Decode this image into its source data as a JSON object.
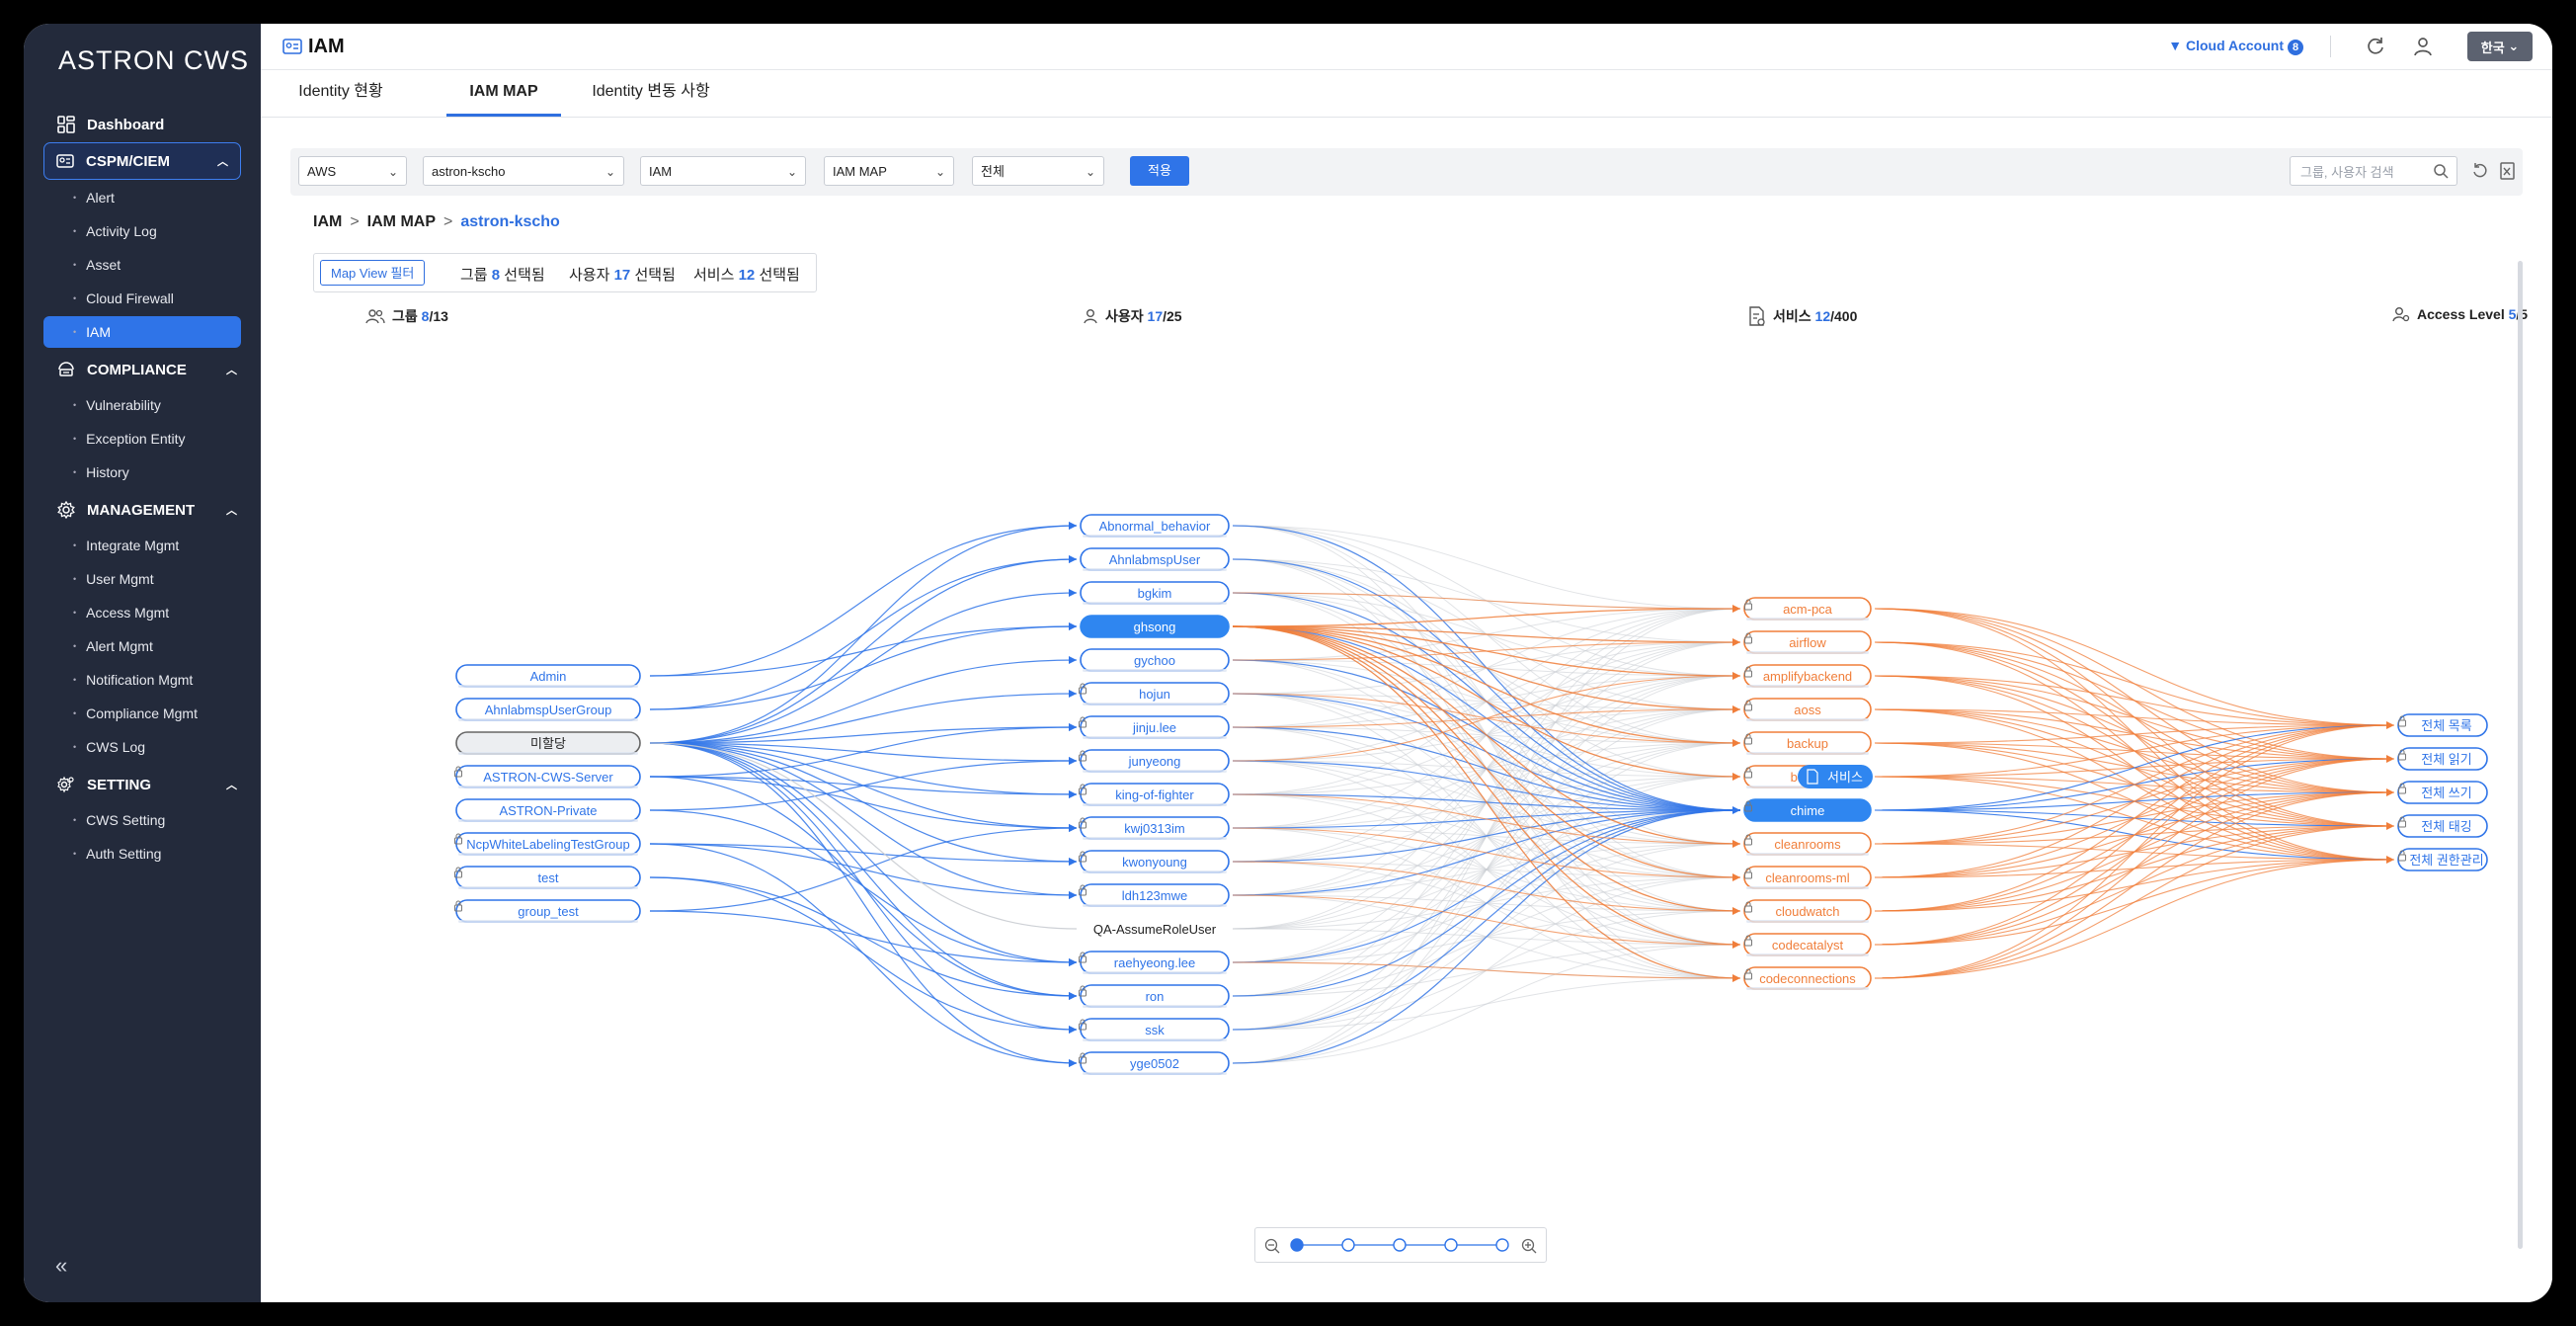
{
  "brand": "ASTRON CWS",
  "sidebar": {
    "dashboard": "Dashboard",
    "sections": [
      {
        "label": "CSPM/CIEM",
        "icon": "cspm-icon",
        "items": [
          "Alert",
          "Activity Log",
          "Asset",
          "Cloud Firewall",
          "IAM"
        ]
      },
      {
        "label": "COMPLIANCE",
        "icon": "compliance-icon",
        "items": [
          "Vulnerability",
          "Exception Entity",
          "History"
        ]
      },
      {
        "label": "MANAGEMENT",
        "icon": "gear-icon",
        "items": [
          "Integrate Mgmt",
          "User Mgmt",
          "Access Mgmt",
          "Alert Mgmt",
          "Notification Mgmt",
          "Compliance Mgmt",
          "CWS Log"
        ]
      },
      {
        "label": "SETTING",
        "icon": "setting-icon",
        "items": [
          "CWS Setting",
          "Auth Setting"
        ]
      }
    ],
    "active_item": "IAM",
    "collapse_label": "«"
  },
  "header": {
    "title": "IAM",
    "cloud_account_label": "▼ Cloud Account",
    "cloud_account_count": "8",
    "lang_label": "한국"
  },
  "tabs": [
    {
      "label": "Identity 현황",
      "active": false
    },
    {
      "label": "IAM MAP",
      "active": true
    },
    {
      "label": "Identity 변동 사항",
      "active": false
    }
  ],
  "filters": {
    "cloud": "AWS",
    "account": "astron-kscho",
    "service": "IAM",
    "view": "IAM MAP",
    "scope": "전체",
    "apply_label": "적용",
    "search_placeholder": "그룹, 사용자 검색"
  },
  "breadcrumb": {
    "root": "IAM",
    "middle": "IAM MAP",
    "current": "astron-kscho",
    "sep": ">"
  },
  "map_filter": {
    "button_label": "Map View 필터",
    "stats": [
      {
        "prefix": "그룹",
        "value": "8",
        "suffix": "선택됨"
      },
      {
        "prefix": "사용자",
        "value": "17",
        "suffix": "선택됨"
      },
      {
        "prefix": "서비스",
        "value": "12",
        "suffix": "선택됨"
      }
    ]
  },
  "columns": [
    {
      "label": "그룹",
      "selected": "8",
      "total": "/13"
    },
    {
      "label": "사용자",
      "selected": "17",
      "total": "/25"
    },
    {
      "label": "서비스",
      "selected": "12",
      "total": "/400"
    },
    {
      "label": "Access Level",
      "selected": "5",
      "total": "/5"
    }
  ],
  "groups": [
    {
      "name": "Admin",
      "state": "normal",
      "lock": false
    },
    {
      "name": "AhnlabmspUserGroup",
      "state": "normal",
      "lock": false
    },
    {
      "name": "미할당",
      "state": "unassigned",
      "lock": false
    },
    {
      "name": "ASTRON-CWS-Server",
      "state": "normal",
      "lock": true
    },
    {
      "name": "ASTRON-Private",
      "state": "normal",
      "lock": false
    },
    {
      "name": "NcpWhiteLabelingTestGroup",
      "state": "normal",
      "lock": true
    },
    {
      "name": "test",
      "state": "normal",
      "lock": true
    },
    {
      "name": "group_test",
      "state": "normal",
      "lock": true
    }
  ],
  "users": [
    {
      "name": "Abnormal_behavior",
      "state": "normal",
      "lock": false
    },
    {
      "name": "AhnlabmspUser",
      "state": "normal",
      "lock": false
    },
    {
      "name": "bgkim",
      "state": "normal",
      "lock": false
    },
    {
      "name": "ghsong",
      "state": "selected",
      "lock": false
    },
    {
      "name": "gychoo",
      "state": "normal",
      "lock": false
    },
    {
      "name": "hojun",
      "state": "normal",
      "lock": true
    },
    {
      "name": "jinju.lee",
      "state": "normal",
      "lock": true
    },
    {
      "name": "junyeong",
      "state": "normal",
      "lock": true
    },
    {
      "name": "king-of-fighter",
      "state": "normal",
      "lock": true
    },
    {
      "name": "kwj0313im",
      "state": "normal",
      "lock": true
    },
    {
      "name": "kwonyoung",
      "state": "normal",
      "lock": true
    },
    {
      "name": "ldh123mwe",
      "state": "normal",
      "lock": true
    },
    {
      "name": "QA-AssumeRoleUser",
      "state": "plain",
      "lock": false
    },
    {
      "name": "raehyeong.lee",
      "state": "normal",
      "lock": true
    },
    {
      "name": "ron",
      "state": "normal",
      "lock": true
    },
    {
      "name": "ssk",
      "state": "normal",
      "lock": true
    },
    {
      "name": "yge0502",
      "state": "normal",
      "lock": true
    }
  ],
  "services": [
    {
      "name": "acm-pca",
      "state": "normal"
    },
    {
      "name": "airflow",
      "state": "normal"
    },
    {
      "name": "amplifybackend",
      "state": "normal"
    },
    {
      "name": "aoss",
      "state": "normal"
    },
    {
      "name": "backup",
      "state": "normal"
    },
    {
      "name": "backup-gateway",
      "state": "hidden-by-tooltip"
    },
    {
      "name": "chime",
      "state": "selected"
    },
    {
      "name": "cleanrooms",
      "state": "normal"
    },
    {
      "name": "cleanrooms-ml",
      "state": "normal"
    },
    {
      "name": "cloudwatch",
      "state": "normal"
    },
    {
      "name": "codecatalyst",
      "state": "normal"
    },
    {
      "name": "codeconnections",
      "state": "normal"
    }
  ],
  "service_visible_partial": "backu",
  "tooltip": {
    "label": "서비스"
  },
  "access_levels": [
    "전체 목록",
    "전체 읽기",
    "전체 쓰기",
    "전체 태깅",
    "전체 권한관리"
  ],
  "colors": {
    "blue": "#2f74e8",
    "orange": "#f07e3a",
    "gray": "#c9ccd2",
    "sidebar": "#232a3b"
  },
  "zoom": {
    "levels": 5,
    "current": 1
  }
}
